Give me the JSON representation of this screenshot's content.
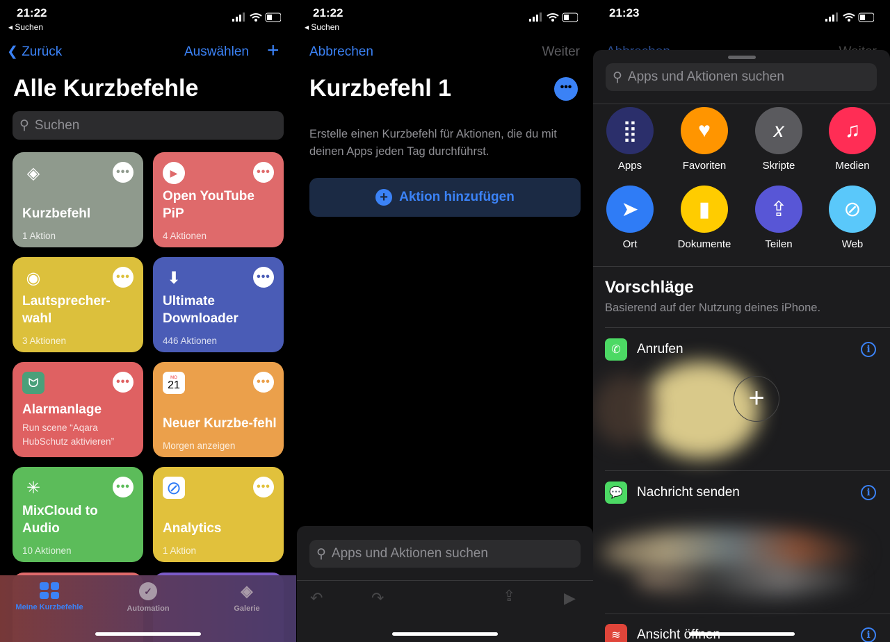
{
  "status": [
    {
      "time": "21:22",
      "back": "◂ Suchen"
    },
    {
      "time": "21:22",
      "back": "◂ Suchen"
    },
    {
      "time": "21:23"
    }
  ],
  "p1": {
    "back": "Zurück",
    "select": "Auswählen",
    "add": "+",
    "title": "Alle Kurzbefehle",
    "search_placeholder": "Suchen",
    "cards": [
      {
        "title": "Kurzbefehl",
        "sub": "1 Aktion",
        "color": "#8f9a8d",
        "icon": "layers-icon"
      },
      {
        "title": "Open YouTube PiP",
        "sub": "4 Aktionen",
        "color": "#df6a6b",
        "icon": "play-icon"
      },
      {
        "title": "Lautsprecher-wahl",
        "sub": "3 Aktionen",
        "color": "#dcc03c",
        "icon": "speaker-icon"
      },
      {
        "title": "Ultimate Downloader",
        "sub": "446 Aktionen",
        "color": "#4a5cb6",
        "icon": "download-icon"
      },
      {
        "title": "Alarmanlage",
        "sub": "Run scene “Aqara HubSchutz aktivieren”",
        "color": "#df6162",
        "icon": "mi-home-icon"
      },
      {
        "title": "Neuer Kurzbe-fehl",
        "sub": "Morgen anzeigen",
        "color": "#eba04b",
        "icon": "calendar-icon",
        "cal_day": "MO",
        "cal_date": "21"
      },
      {
        "title": "MixCloud to Audio",
        "sub": "10 Aktionen",
        "color": "#5cbc5a",
        "icon": "magic-wand-icon"
      },
      {
        "title": "Analytics",
        "sub": "1 Aktion",
        "color": "#e1c13c",
        "icon": "safari-icon"
      }
    ],
    "tabs": [
      {
        "label": "Meine Kurzbefehle",
        "active": true
      },
      {
        "label": "Automation"
      },
      {
        "label": "Galerie"
      }
    ]
  },
  "p2": {
    "cancel": "Abbrechen",
    "next": "Weiter",
    "title": "Kurzbefehl 1",
    "description": "Erstelle einen Kurzbefehl für Aktionen, die du mit deinen Apps jeden Tag durchführst.",
    "add_action": "Aktion hinzufügen",
    "search_placeholder": "Apps und Aktionen suchen"
  },
  "p3": {
    "cancel": "Abbrechen",
    "next": "Weiter",
    "search_placeholder": "Apps und Aktionen suchen",
    "categories": [
      {
        "label": "Apps",
        "color": "#2b2f6b"
      },
      {
        "label": "Favoriten",
        "color": "#ff9500"
      },
      {
        "label": "Skripte",
        "color": "#5a5a5e"
      },
      {
        "label": "Medien",
        "color": "#ff2d55"
      },
      {
        "label": "Ort",
        "color": "#2f7cf6"
      },
      {
        "label": "Dokumente",
        "color": "#ffcc00"
      },
      {
        "label": "Teilen",
        "color": "#5856d6"
      },
      {
        "label": "Web",
        "color": "#5ac8fa"
      }
    ],
    "section_title": "Vorschläge",
    "section_sub": "Basierend auf der Nutzung deines iPhone.",
    "suggestions": [
      {
        "label": "Anrufen",
        "color": "#4cd964"
      },
      {
        "label": "Nachricht senden",
        "color": "#4cd964"
      },
      {
        "label": "Ansicht öffnen",
        "color": "#e0453a"
      }
    ]
  }
}
